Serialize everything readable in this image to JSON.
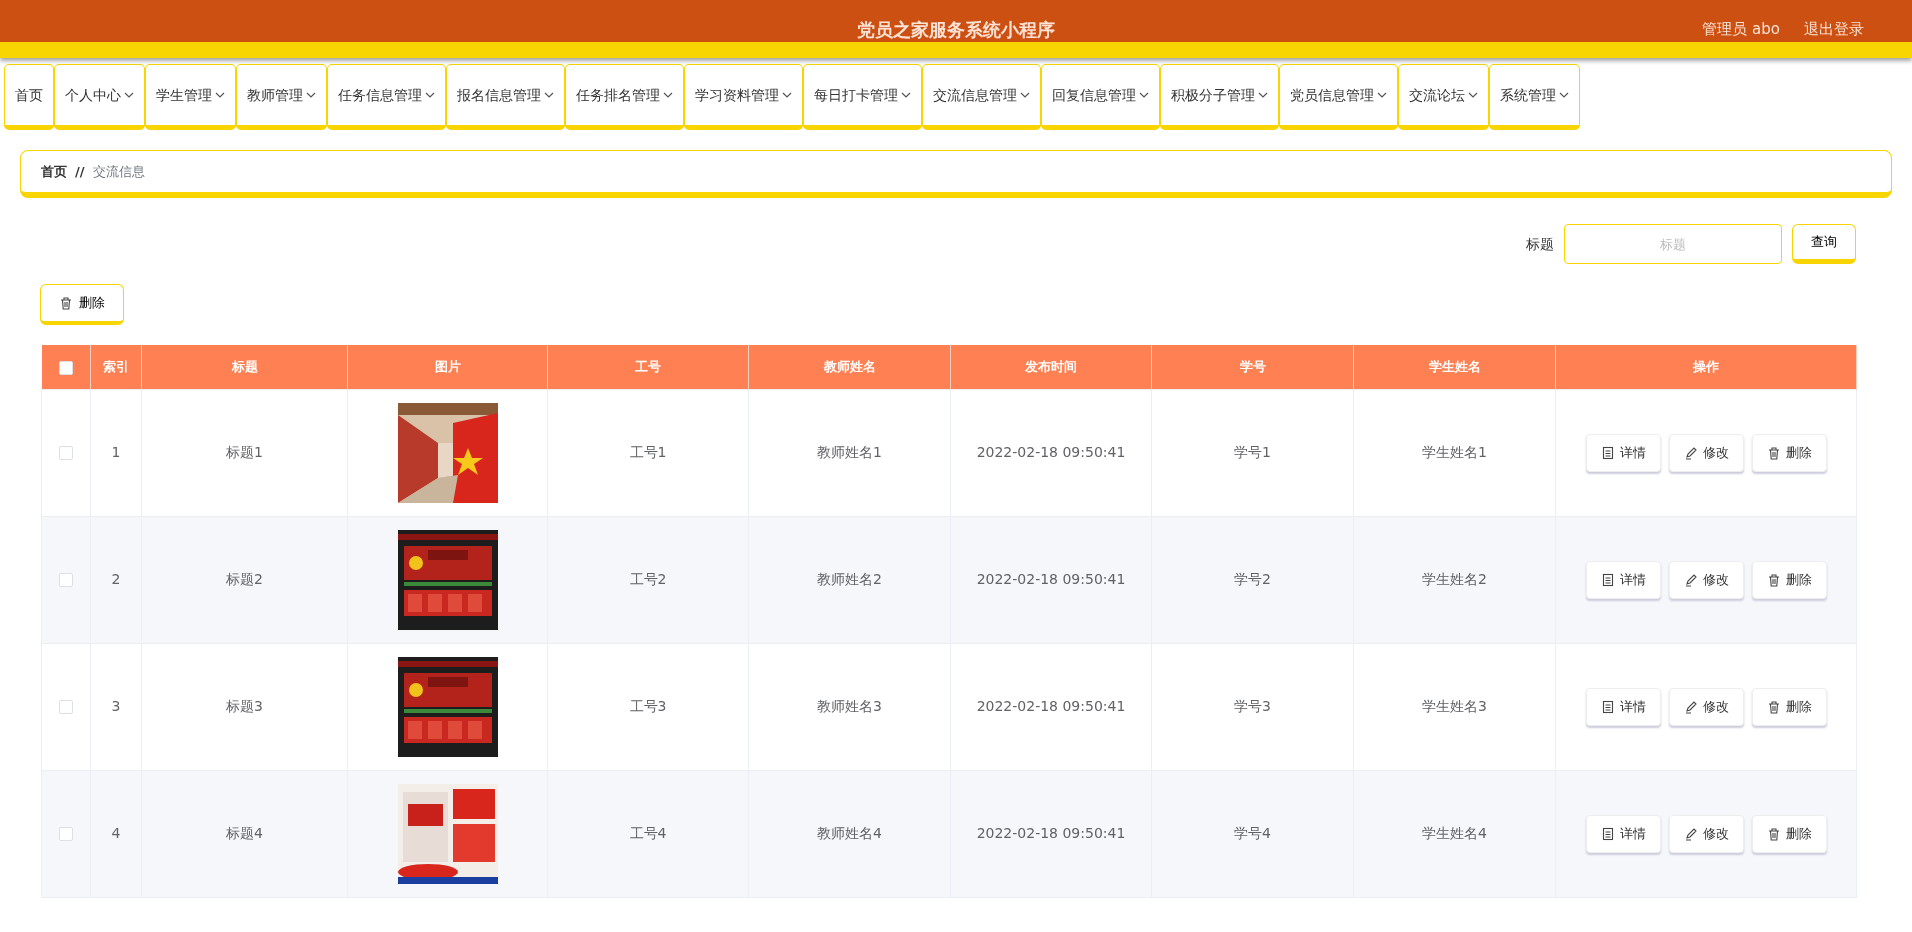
{
  "header": {
    "title": "党员之家服务系统小程序",
    "user": "管理员 abo",
    "logout": "退出登录"
  },
  "nav": [
    {
      "label": "首页",
      "has_dropdown": false
    },
    {
      "label": "个人中心",
      "has_dropdown": true
    },
    {
      "label": "学生管理",
      "has_dropdown": true
    },
    {
      "label": "教师管理",
      "has_dropdown": true
    },
    {
      "label": "任务信息管理",
      "has_dropdown": true
    },
    {
      "label": "报名信息管理",
      "has_dropdown": true
    },
    {
      "label": "任务排名管理",
      "has_dropdown": true
    },
    {
      "label": "学习资料管理",
      "has_dropdown": true
    },
    {
      "label": "每日打卡管理",
      "has_dropdown": true
    },
    {
      "label": "交流信息管理",
      "has_dropdown": true
    },
    {
      "label": "回复信息管理",
      "has_dropdown": true
    },
    {
      "label": "积极分子管理",
      "has_dropdown": true
    },
    {
      "label": "党员信息管理",
      "has_dropdown": true
    },
    {
      "label": "交流论坛",
      "has_dropdown": true
    },
    {
      "label": "系统管理",
      "has_dropdown": true
    }
  ],
  "breadcrumb": {
    "home": "首页",
    "separator": "//",
    "current": "交流信息"
  },
  "search": {
    "label": "标题",
    "placeholder": "标题",
    "button": "查询"
  },
  "bulk_delete": "删除",
  "table": {
    "columns": [
      "索引",
      "标题",
      "图片",
      "工号",
      "教师姓名",
      "发布时间",
      "学号",
      "学生姓名",
      "操作"
    ],
    "header_checked": false,
    "rows": [
      {
        "selected": false,
        "index": "1",
        "title": "标题1",
        "picture": {
          "kind": "picture"
        },
        "staff_no": "工号1",
        "teacher": "教师姓名1",
        "time": "2022-02-18 09:50:41",
        "student_no": "学号1",
        "student": "学生姓名1",
        "actions": [
          "详情",
          "修改",
          "删除"
        ]
      },
      {
        "selected": false,
        "index": "2",
        "title": "标题2",
        "picture": {
          "kind": "picture"
        },
        "staff_no": "工号2",
        "teacher": "教师姓名2",
        "time": "2022-02-18 09:50:41",
        "student_no": "学号2",
        "student": "学生姓名2",
        "actions": [
          "详情",
          "修改",
          "删除"
        ]
      },
      {
        "selected": false,
        "index": "3",
        "title": "标题3",
        "picture": {
          "kind": "picture"
        },
        "staff_no": "工号3",
        "teacher": "教师姓名3",
        "time": "2022-02-18 09:50:41",
        "student_no": "学号3",
        "student": "学生姓名3",
        "actions": [
          "详情",
          "修改",
          "删除"
        ]
      },
      {
        "selected": false,
        "index": "4",
        "title": "标题4",
        "picture": {
          "kind": "picture"
        },
        "staff_no": "工号4",
        "teacher": "教师姓名4",
        "time": "2022-02-18 09:50:41",
        "student_no": "学号4",
        "student": "学生姓名4",
        "actions": [
          "详情",
          "修改",
          "删除"
        ]
      }
    ]
  }
}
